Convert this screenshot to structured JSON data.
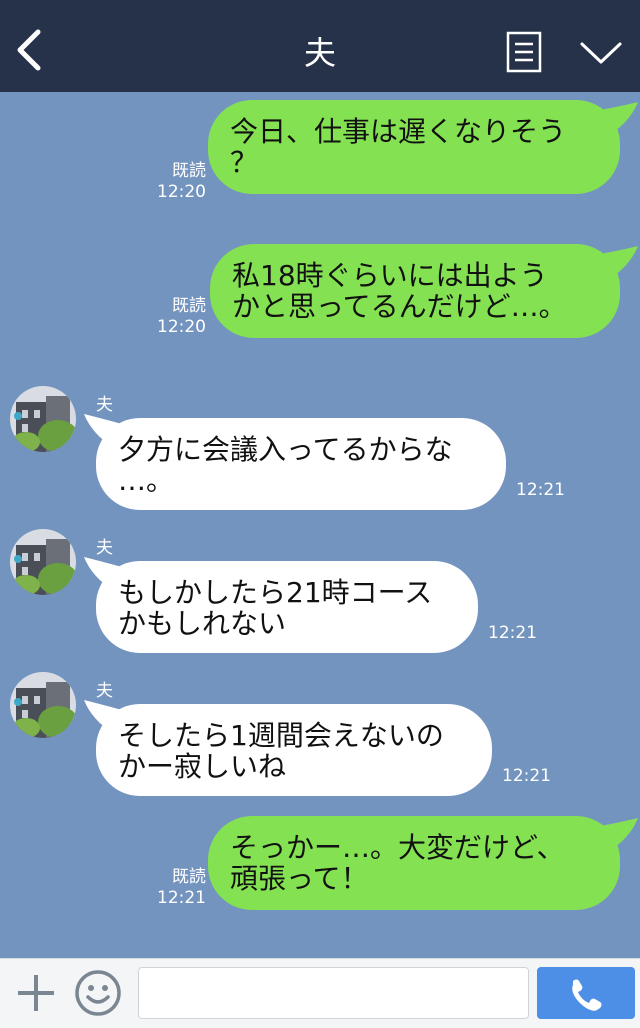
{
  "header": {
    "title": "夫",
    "back_icon": "chevron-left-icon",
    "menu_icon": "list-icon",
    "collapse_icon": "chevron-down-icon"
  },
  "messages": [
    {
      "direction": "out",
      "lines": [
        "今日、仕事は遅くなりそう",
        "？"
      ],
      "read": "既読",
      "time": "12:20"
    },
    {
      "direction": "out",
      "lines": [
        "私18時ぐらいには出よう",
        "かと思ってるんだけど…。"
      ],
      "read": "既読",
      "time": "12:20"
    },
    {
      "direction": "in",
      "sender": "夫",
      "lines": [
        "夕方に会議入ってるからな",
        "…。"
      ],
      "time": "12:21"
    },
    {
      "direction": "in",
      "sender": "夫",
      "lines": [
        "もしかしたら21時コース",
        "かもしれない"
      ],
      "time": "12:21"
    },
    {
      "direction": "in",
      "sender": "夫",
      "lines": [
        "そしたら1週間会えないの",
        "かー寂しいね"
      ],
      "time": "12:21"
    },
    {
      "direction": "out",
      "lines": [
        "そっかー…。大変だけど、",
        "頑張って！"
      ],
      "read": "既読",
      "time": "12:21"
    }
  ],
  "input": {
    "value": "",
    "plus_icon": "plus-icon",
    "emoji_icon": "smiley-icon",
    "call_icon": "phone-icon"
  },
  "colors": {
    "header_bg": "#263249",
    "chat_bg": "#7494c0",
    "outgoing_bubble": "#84e152",
    "incoming_bubble": "#ffffff",
    "call_button": "#4d8ee6"
  }
}
